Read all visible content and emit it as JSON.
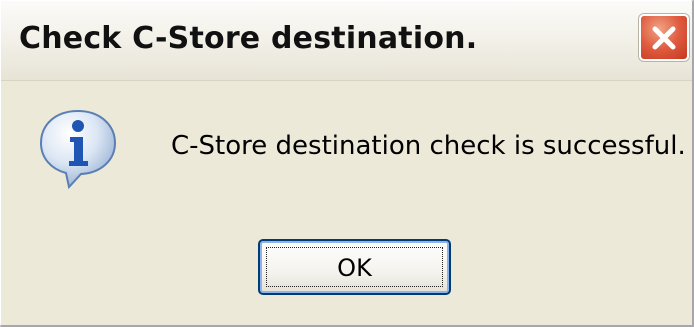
{
  "window": {
    "title": "Check C-Store destination.",
    "close_icon": "close-icon"
  },
  "dialog": {
    "icon": "info-icon",
    "message": "C-Store destination check is successful.",
    "ok_label": "OK"
  },
  "colors": {
    "close_red": "#df5b3f",
    "button_border": "#003c74",
    "dialog_bg": "#ece9d8"
  }
}
